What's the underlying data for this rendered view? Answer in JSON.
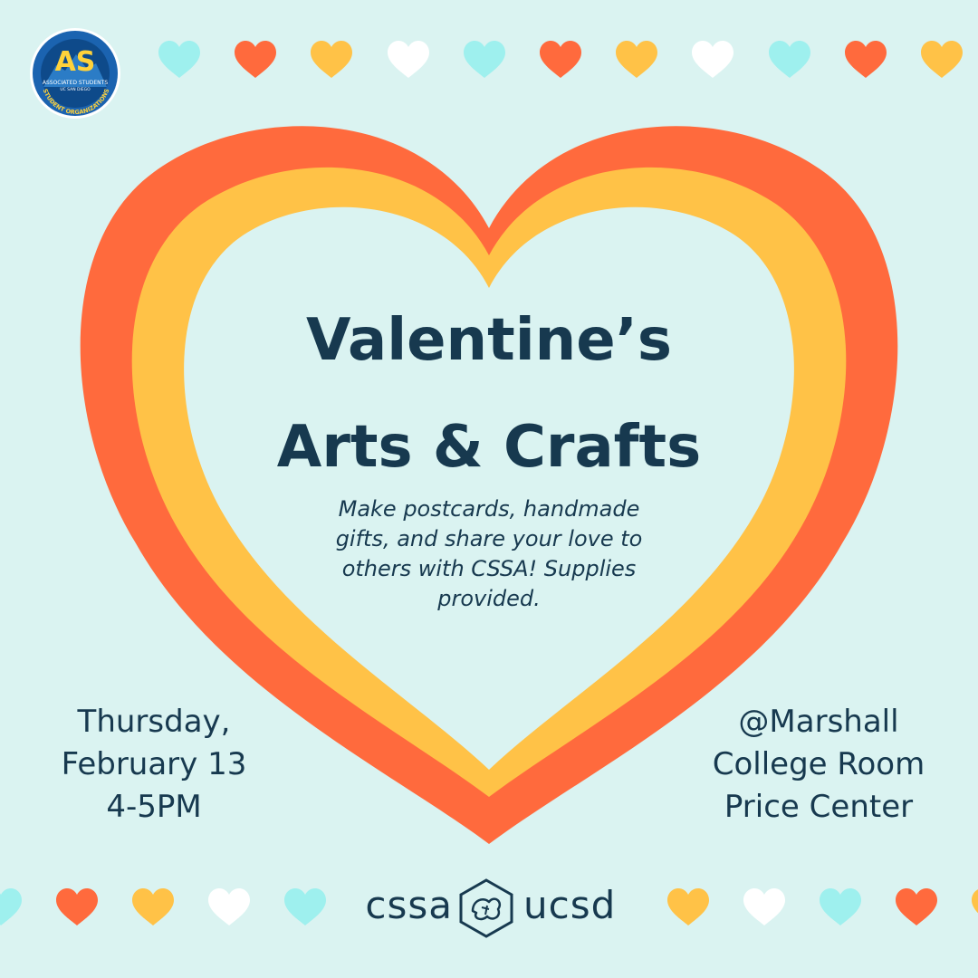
{
  "logo": {
    "initials": "AS",
    "line1": "ASSOCIATED STUDENTS",
    "line2": "UC SAN DIEGO",
    "ring_text": "STUDENT ORGANIZATIONS"
  },
  "title": {
    "line1": "Valentine’s",
    "line2": "Arts & Crafts"
  },
  "tagline": {
    "line1": "Make postcards, handmade",
    "line2": "gifts, and share your love to",
    "line3": "others with CSSA! Supplies",
    "line4": "provided."
  },
  "when": {
    "day": "Thursday,",
    "date": "February 13",
    "time": "4-5PM"
  },
  "where": {
    "line1": "@Marshall",
    "line2": "College Room",
    "line3": "Price Center"
  },
  "brand": {
    "left": "cssa",
    "right": "ucsd",
    "emblem_icon": "cssa-emblem-icon"
  },
  "colors": {
    "background": "#daf3f1",
    "outer_heart": "#ff6a3d",
    "middle_heart": "#ffc247",
    "text": "#17394f",
    "cyan": "#9ef0ee",
    "white": "#ffffff",
    "yellow": "#ffc247",
    "orange": "#ff6a3d"
  },
  "top_hearts": [
    "cyan",
    "orange",
    "yellow",
    "white",
    "cyan",
    "orange",
    "yellow",
    "white",
    "cyan",
    "orange",
    "yellow"
  ],
  "bottom_hearts_left": [
    "cyan",
    "orange",
    "yellow",
    "white",
    "cyan"
  ],
  "bottom_hearts_right": [
    "yellow",
    "white",
    "cyan",
    "orange",
    "yellow"
  ]
}
